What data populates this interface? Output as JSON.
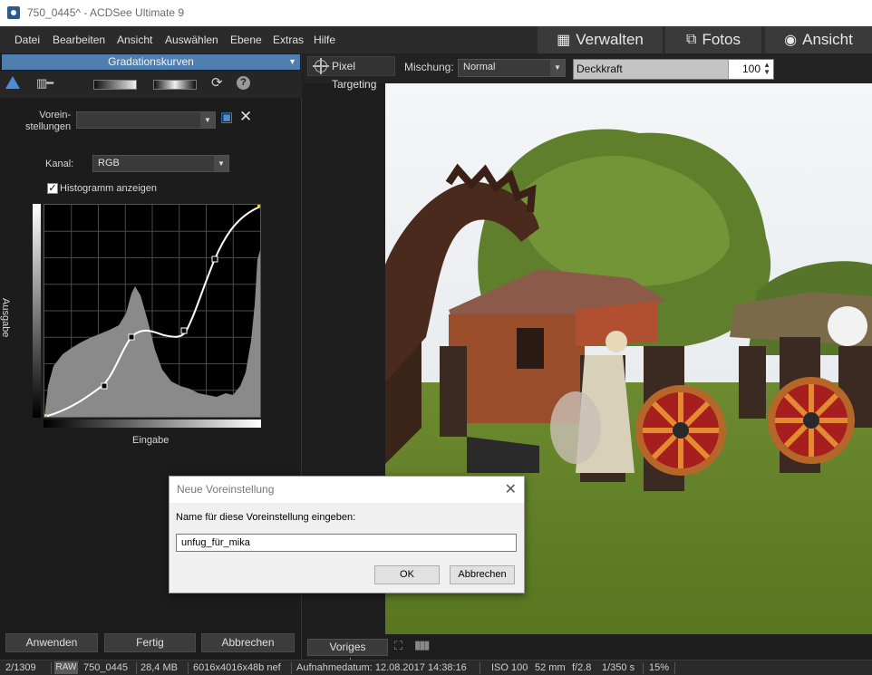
{
  "window": {
    "title": "750_0445^ - ACDSee Ultimate 9"
  },
  "menu": [
    "Datei",
    "Bearbeiten",
    "Ansicht",
    "Auswählen",
    "Ebene",
    "Extras",
    "Hilfe"
  ],
  "modes": {
    "manage": "Verwalten",
    "photos": "Fotos",
    "view": "Ansicht"
  },
  "panel": {
    "title": "Gradationskurven",
    "presets_label": "Vorein-\nstellungen",
    "presets_value": "",
    "channel_label": "Kanal:",
    "channel_value": "RGB",
    "histogram_label": "Histogramm anzeigen",
    "histogram_checked": true,
    "axis_output": "Ausgabe",
    "axis_input": "Eingabe",
    "apply": "Anwenden",
    "done": "Fertig",
    "cancel": "Abbrechen"
  },
  "toolbar": {
    "pixel_targeting": "Pixel Targeting",
    "blend_label": "Mischung:",
    "blend_value": "Normal",
    "opacity_label": "Deckkraft",
    "opacity_value": "100"
  },
  "viewer": {
    "show_previous": "Voriges anzeigen"
  },
  "status": {
    "position": "2/1309",
    "badge": "RAW",
    "filename": "750_0445",
    "filesize": "28,4 MB",
    "dimensions": "6016x4016x48b nef",
    "date": "Aufnahmedatum: 12.08.2017 14:38:16",
    "iso": "ISO 100",
    "focal": "52 mm",
    "aperture": "f/2.8",
    "shutter": "1/350 s",
    "zoom": "15%"
  },
  "dialog": {
    "title": "Neue Voreinstellung",
    "prompt": "Name für diese Voreinstellung eingeben:",
    "value": "unfug_für_mika",
    "ok": "OK",
    "cancel": "Abbrechen"
  },
  "colors": {
    "accent": "#4e7fb0",
    "background": "#1e1e1e",
    "dialog": "#f0f0f0"
  }
}
